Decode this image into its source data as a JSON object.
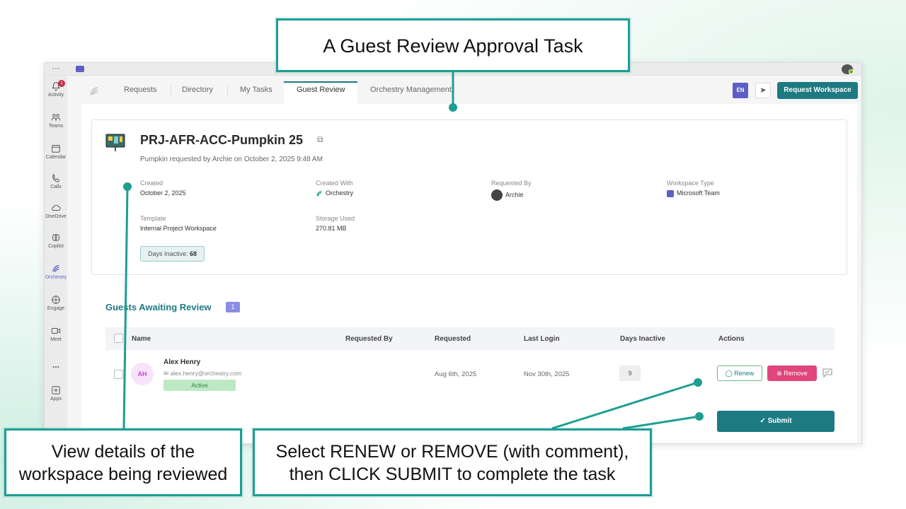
{
  "callouts": {
    "top": "A Guest Review Approval Task",
    "left_line1": "View details of the",
    "left_line2": "workspace being reviewed",
    "right_line1": "Select RENEW or REMOVE (with comment),",
    "right_line2": "then CLICK SUBMIT to complete the task"
  },
  "rail": {
    "items": [
      {
        "label": "Activity",
        "icon": "bell-icon",
        "badge": "1"
      },
      {
        "label": "Teams",
        "icon": "teams-icon"
      },
      {
        "label": "Calendar",
        "icon": "calendar-icon"
      },
      {
        "label": "Calls",
        "icon": "phone-icon"
      },
      {
        "label": "OneDrive",
        "icon": "cloud-icon"
      },
      {
        "label": "Copilot",
        "icon": "copilot-icon"
      },
      {
        "label": "Orchestry",
        "icon": "orchestry-icon"
      },
      {
        "label": "Engage",
        "icon": "engage-icon"
      },
      {
        "label": "Meet",
        "icon": "video-icon"
      },
      {
        "label": "...",
        "icon": "more-icon"
      },
      {
        "label": "Apps",
        "icon": "plus-icon"
      }
    ]
  },
  "nav": {
    "tabs": [
      "Requests",
      "Directory",
      "My Tasks",
      "Guest Review",
      "Orchestry Management"
    ],
    "active_tab": "Guest Review",
    "lang": "EN",
    "request_button": "Request Workspace"
  },
  "workspace": {
    "title": "PRJ-AFR-ACC-Pumpkin 25",
    "subtitle": "Pumpkin requested by Archie on October 2, 2025 9:48 AM",
    "created_label": "Created",
    "created_value": "October 2, 2025",
    "created_with_label": "Created With",
    "created_with_value": "Orchestry",
    "requested_by_label": "Requested By",
    "requested_by_value": "Archie",
    "workspace_type_label": "Workspace Type",
    "workspace_type_value": "Microsoft Team",
    "template_label": "Template",
    "template_value": "Internal Project Workspace",
    "storage_label": "Storage Used",
    "storage_value": "270.81 MB",
    "days_inactive_label": "Days Inactive:",
    "days_inactive_value": "68"
  },
  "guests": {
    "title": "Guests Awaiting Review",
    "count": "1",
    "columns": [
      "Name",
      "Requested By",
      "Requested",
      "Last Login",
      "Days Inactive",
      "Actions"
    ],
    "rows": [
      {
        "initials": "AH",
        "name": "Alex Henry",
        "email": "alex.henry@orchestry.com",
        "status": "Active",
        "requested_by": "",
        "requested": "Aug 6th, 2025",
        "last_login": "Nov 30th, 2025",
        "days_inactive": "9"
      }
    ],
    "renew_label": "Renew",
    "remove_label": "Remove",
    "submit_label": "Submit"
  },
  "colors": {
    "accent": "#1d7a82",
    "callout_border": "#1d9e92",
    "remove": "#e0457b",
    "teams_purple": "#5b5fc7"
  }
}
